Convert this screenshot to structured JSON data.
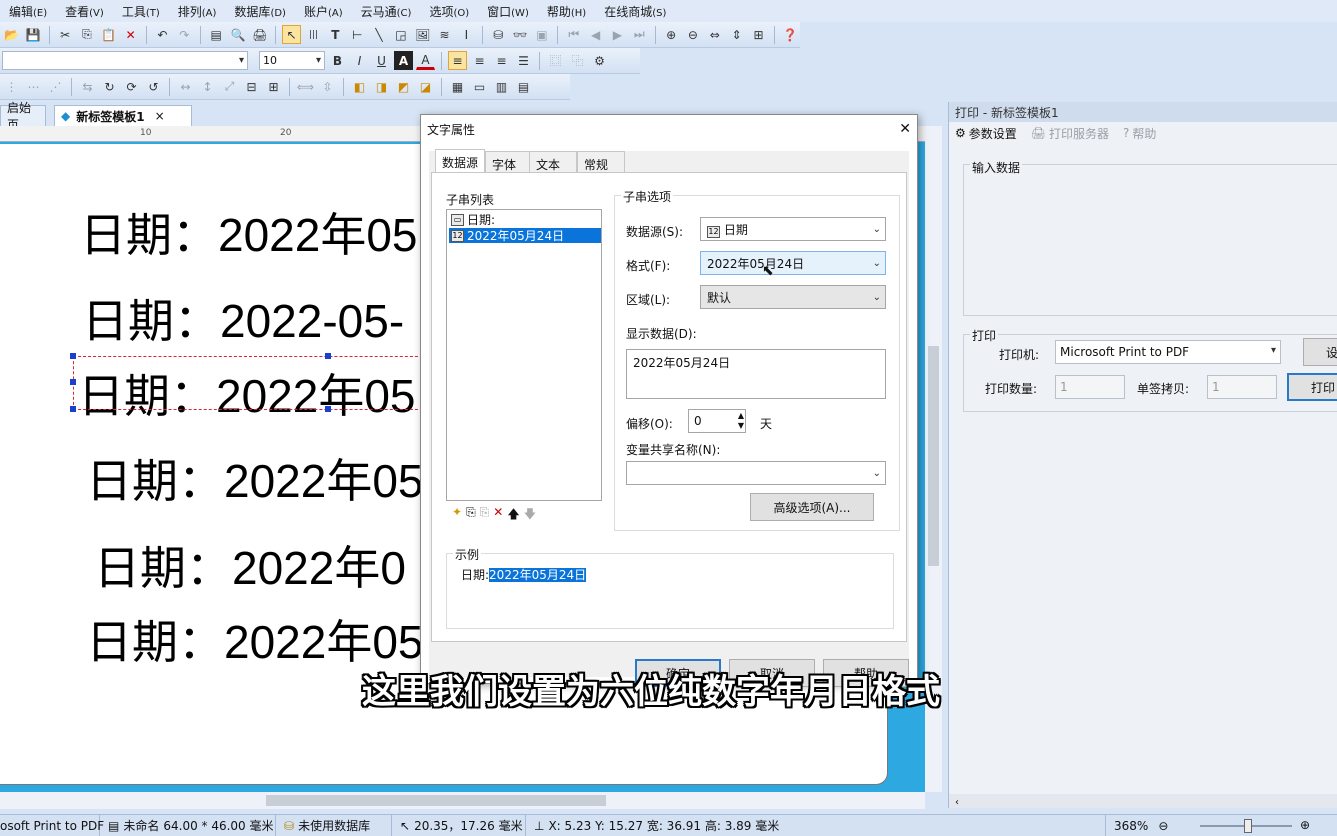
{
  "menu": [
    {
      "label": "编辑",
      "acc": "(E)"
    },
    {
      "label": "查看",
      "acc": "(V)"
    },
    {
      "label": "工具",
      "acc": "(T)"
    },
    {
      "label": "排列",
      "acc": "(A)"
    },
    {
      "label": "数据库",
      "acc": "(D)"
    },
    {
      "label": "账户",
      "acc": "(A)"
    },
    {
      "label": "云马通",
      "acc": "(C)"
    },
    {
      "label": "选项",
      "acc": "(O)"
    },
    {
      "label": "窗口",
      "acc": "(W)"
    },
    {
      "label": "帮助",
      "acc": "(H)"
    },
    {
      "label": "在线商城",
      "acc": "(S)"
    }
  ],
  "toolbar": {
    "font_size_value": "10",
    "text_tool_glyph": "T",
    "barcode_glyph": "|||"
  },
  "doc_tabs": {
    "start": "启始页",
    "active": "新标签模板1",
    "close": "×"
  },
  "ruler": {
    "ticks": [
      "10",
      "20"
    ]
  },
  "canvas": {
    "lines": [
      "日期：2022年05",
      "日期：2022-05-",
      "日期：2022年05",
      "日期：2022年05",
      "日期：2022年0",
      "日期：2022年05"
    ]
  },
  "dialog": {
    "title": "文字属性",
    "close": "✕",
    "tabs": [
      "数据源",
      "字体",
      "文本",
      "常规"
    ],
    "substring_list_title": "子串列表",
    "list_items": [
      "日期:",
      "2022年05月24日"
    ],
    "options_title": "子串选项",
    "datasource_label": "数据源(S):",
    "datasource_value": "日期",
    "format_label": "格式(F):",
    "format_value": "2022年05月24日",
    "region_label": "区域(L):",
    "region_value": "默认",
    "display_label": "显示数据(D):",
    "display_value": "2022年05月24日",
    "offset_label": "偏移(O):",
    "offset_value": "0",
    "offset_unit": "天",
    "shared_var_label": "变量共享名称(N):",
    "shared_var_value": "",
    "advanced_button": "高级选项(A)...",
    "example_title": "示例",
    "example_prefix": "日期:",
    "example_value": "2022年05月24日",
    "footer_buttons": [
      "确定",
      "取消",
      "帮助"
    ]
  },
  "print_panel": {
    "title": "打印 - 新标签模板1",
    "tools": [
      "参数设置",
      "打印服务器",
      "帮助"
    ],
    "input_group": "输入数据",
    "print_group": "打印",
    "printer_label": "打印机:",
    "printer_value": "Microsoft Print to PDF",
    "settings_button": "设",
    "quantity_label": "打印数量:",
    "quantity_value": "1",
    "copies_label": "单签拷贝:",
    "copies_value": "1",
    "print_button": "打印"
  },
  "subtitle": "这里我们设置为六位纯数字年月日格式",
  "status": {
    "printer": "osoft Print to PDF",
    "doc": "未命名",
    "size": "64.00 * 46.00 毫米",
    "db": "未使用数据库",
    "cursor": "20.35，17.26 毫米",
    "geometry": "X:  5.23  Y:  15.27  宽:  36.91  高:  3.89  毫米",
    "zoom": "368%"
  }
}
